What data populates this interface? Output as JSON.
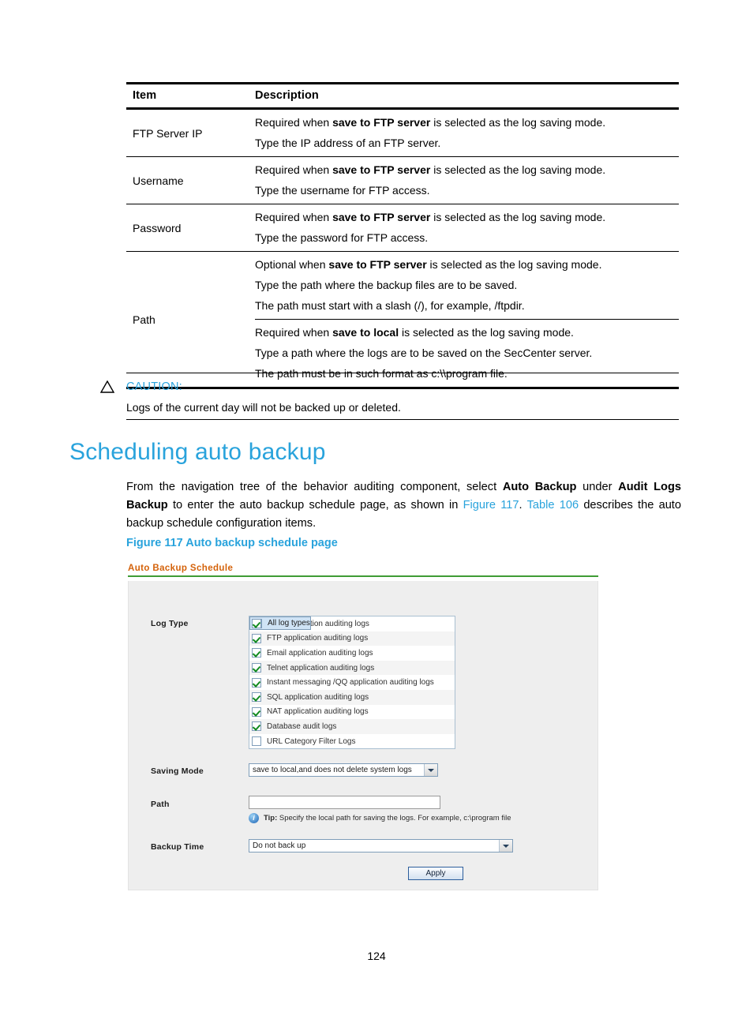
{
  "table": {
    "headers": [
      "Item",
      "Description"
    ],
    "rows": [
      {
        "item": "FTP Server IP",
        "blocks": [
          {
            "lines": [
              {
                "pre": "Required when ",
                "bold": "save to FTP server",
                "post": " is selected as the log saving mode."
              },
              {
                "pre": "Type the IP address of an FTP server.",
                "bold": "",
                "post": ""
              }
            ]
          }
        ]
      },
      {
        "item": "Username",
        "blocks": [
          {
            "lines": [
              {
                "pre": "Required when ",
                "bold": "save to FTP server",
                "post": " is selected as the log saving mode."
              },
              {
                "pre": "Type the username for FTP access.",
                "bold": "",
                "post": ""
              }
            ]
          }
        ]
      },
      {
        "item": "Password",
        "blocks": [
          {
            "lines": [
              {
                "pre": "Required when ",
                "bold": "save to FTP server",
                "post": " is selected as the log saving mode."
              },
              {
                "pre": "Type the password for FTP access.",
                "bold": "",
                "post": ""
              }
            ]
          }
        ]
      },
      {
        "item": "Path",
        "blocks": [
          {
            "lines": [
              {
                "pre": "Optional when ",
                "bold": "save to FTP server",
                "post": " is selected as the log saving mode."
              },
              {
                "pre": "Type the path where the backup files are to be saved.",
                "bold": "",
                "post": ""
              },
              {
                "pre": "The path must start with a slash (/), for example, /ftpdir.",
                "bold": "",
                "post": ""
              }
            ]
          },
          {
            "lines": [
              {
                "pre": "Required when ",
                "bold": "save to local",
                "post": " is selected as the log saving mode."
              },
              {
                "pre": "Type a path where the logs are to be saved on the SecCenter server.",
                "bold": "",
                "post": ""
              },
              {
                "pre": "The path must be in such format as c:\\\\program file.",
                "bold": "",
                "post": ""
              }
            ]
          }
        ]
      }
    ]
  },
  "caution": {
    "label": "CAUTION:",
    "text": "Logs of the current day will not be backed up or deleted."
  },
  "heading": "Scheduling auto backup",
  "paragraph": {
    "part1": "From the navigation tree of the behavior auditing component, select ",
    "bold1": "Auto Backup",
    "part2": " under ",
    "bold2": "Audit Logs Backup",
    "part3": " to enter the auto backup schedule page, as shown in ",
    "link1": "Figure 117",
    "part4": ". ",
    "link2": "Table 106",
    "part5": " describes the auto backup schedule configuration items."
  },
  "figure_caption": "Figure 117 Auto backup schedule page",
  "screenshot": {
    "title": "Auto Backup Schedule",
    "labels": {
      "log_type": "Log Type",
      "saving_mode": "Saving Mode",
      "path": "Path",
      "backup_time": "Backup Time"
    },
    "log_types": [
      {
        "label": "All log types",
        "checked": false,
        "selected": true
      },
      {
        "label": "Web application auditing logs",
        "checked": true,
        "selected": false
      },
      {
        "label": "FTP application auditing logs",
        "checked": true,
        "selected": false
      },
      {
        "label": "Email application auditing logs",
        "checked": true,
        "selected": false
      },
      {
        "label": "Telnet application auditing logs",
        "checked": true,
        "selected": false
      },
      {
        "label": "Instant messaging /QQ application auditing logs",
        "checked": true,
        "selected": false
      },
      {
        "label": "SQL application auditing logs",
        "checked": true,
        "selected": false
      },
      {
        "label": "NAT application auditing logs",
        "checked": true,
        "selected": false
      },
      {
        "label": "Database audit logs",
        "checked": true,
        "selected": false
      },
      {
        "label": "URL Category Filter Logs",
        "checked": false,
        "selected": false
      }
    ],
    "saving_mode_value": "save to local,and does not delete system logs",
    "path_value": "",
    "tip_label": "Tip:",
    "tip_text": " Specify the local path for saving the logs. For example, c:\\program file",
    "backup_time_value": "Do not back up",
    "apply_label": "Apply"
  },
  "page_number": "124"
}
